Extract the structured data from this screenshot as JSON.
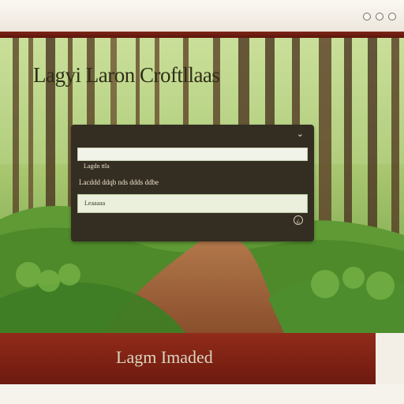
{
  "brand": {
    "title": "Lagyi Laron Croftllaas"
  },
  "dialog": {
    "label": "Lagdn ttla",
    "description": "Lacddd ddqb nds ddds ddbe",
    "input_value": "Leaaaaa",
    "close_icon": "close-icon",
    "help_icon": "help-icon"
  },
  "footer": {
    "text": "Lagm Imaded"
  },
  "colors": {
    "accent": "#7d2416",
    "panel": "#332d22",
    "forest": "#2f6a1f"
  }
}
